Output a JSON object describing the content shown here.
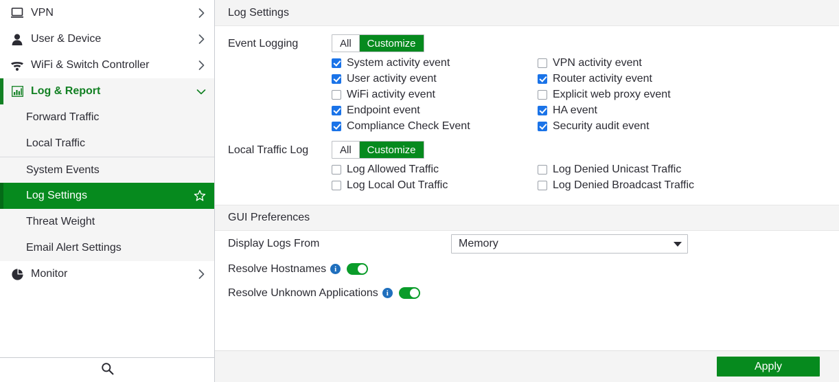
{
  "sidebar": {
    "items": [
      {
        "label": "VPN",
        "icon": "monitor-icon",
        "chevron": "chevron-right-icon",
        "state": "collapsed"
      },
      {
        "label": "User & Device",
        "icon": "user-icon",
        "chevron": "chevron-right-icon",
        "state": "collapsed"
      },
      {
        "label": "WiFi & Switch Controller",
        "icon": "wifi-icon",
        "chevron": "chevron-right-icon",
        "state": "collapsed"
      },
      {
        "label": "Log & Report",
        "icon": "bar-chart-icon",
        "chevron": "chevron-down-icon",
        "state": "expanded"
      }
    ],
    "sub_items": [
      {
        "label": "Forward Traffic",
        "active": false
      },
      {
        "label": "Local Traffic",
        "active": false
      },
      {
        "label": "System Events",
        "active": false
      },
      {
        "label": "Log Settings",
        "active": true,
        "star": "star-icon"
      },
      {
        "label": "Threat Weight",
        "active": false
      },
      {
        "label": "Email Alert Settings",
        "active": false
      }
    ],
    "monitor": {
      "label": "Monitor",
      "icon": "pie-chart-icon",
      "chevron": "chevron-right-icon"
    },
    "footer": {
      "icon": "search-icon"
    }
  },
  "main": {
    "log_settings": {
      "header": "Log Settings",
      "event_logging": {
        "label": "Event Logging",
        "segments": [
          {
            "label": "All",
            "selected": false
          },
          {
            "label": "Customize",
            "selected": true
          }
        ],
        "left_column": [
          {
            "label": "System activity event",
            "checked": true
          },
          {
            "label": "User activity event",
            "checked": true
          },
          {
            "label": "WiFi activity event",
            "checked": false
          },
          {
            "label": "Endpoint event",
            "checked": true
          },
          {
            "label": "Compliance Check Event",
            "checked": true
          }
        ],
        "right_column": [
          {
            "label": "VPN activity event",
            "checked": false
          },
          {
            "label": "Router activity event",
            "checked": true
          },
          {
            "label": "Explicit web proxy event",
            "checked": false
          },
          {
            "label": "HA event",
            "checked": true
          },
          {
            "label": "Security audit event",
            "checked": true
          }
        ]
      },
      "local_traffic_log": {
        "label": "Local Traffic Log",
        "segments": [
          {
            "label": "All",
            "selected": false
          },
          {
            "label": "Customize",
            "selected": true
          }
        ],
        "left_column": [
          {
            "label": "Log Allowed Traffic",
            "checked": false
          },
          {
            "label": "Log Local Out Traffic",
            "checked": false
          }
        ],
        "right_column": [
          {
            "label": "Log Denied Unicast Traffic",
            "checked": false
          },
          {
            "label": "Log Denied Broadcast Traffic",
            "checked": false
          }
        ]
      }
    },
    "gui_preferences": {
      "header": "GUI Preferences",
      "display_logs_from": {
        "label": "Display Logs From",
        "value": "Memory",
        "caret": "chevron-down-icon"
      },
      "resolve_hostnames": {
        "label": "Resolve Hostnames",
        "info": "i",
        "enabled": true
      },
      "resolve_unknown_applications": {
        "label": "Resolve Unknown Applications",
        "info": "i",
        "enabled": true
      }
    },
    "footer": {
      "apply_label": "Apply"
    }
  },
  "colors": {
    "brand_green": "#068a1e",
    "accent_green": "#128023",
    "checkbox_blue": "#1a73e8",
    "info_blue": "#1f6fbd",
    "toggle_green": "#0a9c2a",
    "section_bg": "#f4f4f4"
  }
}
